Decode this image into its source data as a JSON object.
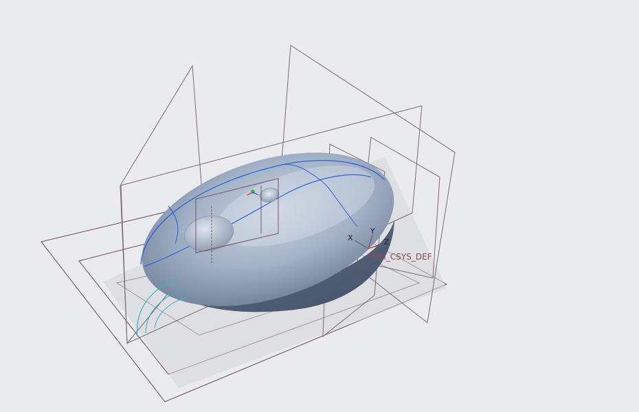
{
  "viewport": {
    "background_color": "#e9ebee",
    "model": "computer-mouse-surface-model",
    "datum_plane_color": "#6e4a55",
    "model_color": "#9eacbf",
    "edge_highlight_color": "#2a63d9",
    "curve_color": "#2fb6c9"
  },
  "csys": {
    "name": "PRM_CSYS_DEF",
    "axis_x": "X",
    "axis_y": "Y",
    "axis_z": "Z"
  }
}
